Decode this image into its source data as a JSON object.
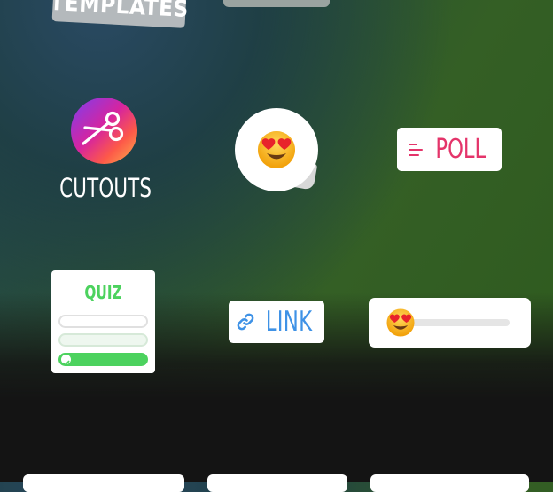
{
  "stickers": {
    "templates": {
      "label": "TEMPLATES",
      "icon": "templates-sticker"
    },
    "cutouts": {
      "label": "CUTOUTS",
      "icon": "scissors-icon",
      "gradient": [
        "#7b3ff0",
        "#d6249f",
        "#fd5949",
        "#fdb44b"
      ]
    },
    "emoji_reaction": {
      "icon": "heart-eyes-emoji-icon"
    },
    "poll": {
      "label": "POLL",
      "icon": "poll-lines-icon",
      "color": "#e4346a"
    },
    "quiz": {
      "title": "QUIZ",
      "selected_option": 3,
      "color": "#4cd25e"
    },
    "link": {
      "label": "LINK",
      "icon": "link-icon",
      "color": "#3f92e6"
    },
    "emoji_slider": {
      "icon": "heart-eyes-emoji-icon",
      "value": 0
    }
  },
  "colors": {
    "background_top": "#22474f",
    "background_green": "#345f25",
    "background_bottom": "#141414"
  }
}
